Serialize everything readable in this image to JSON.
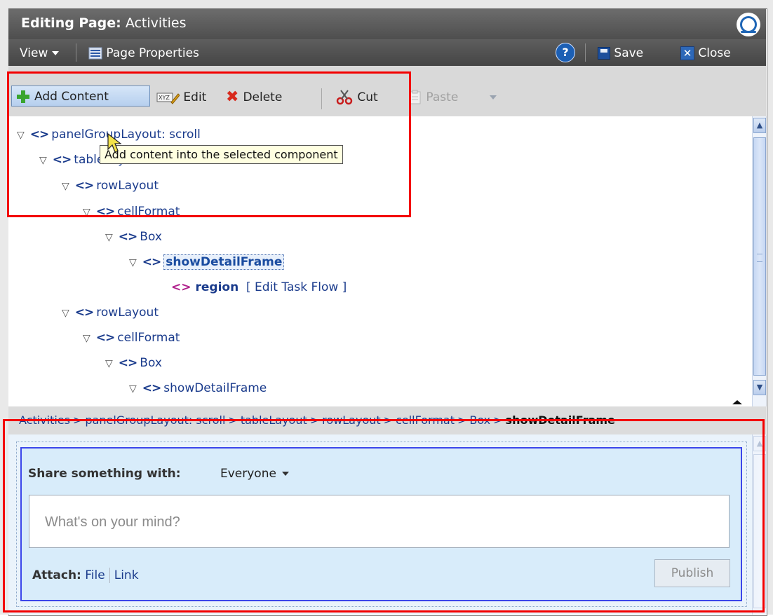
{
  "window": {
    "title_prefix": "Editing Page:",
    "title_page": "Activities"
  },
  "menubar": {
    "view_label": "View",
    "page_properties_label": "Page Properties",
    "help_label": "?",
    "save_label": "Save",
    "close_label": "Close"
  },
  "toolbar": {
    "add_content_label": "Add Content",
    "edit_label": "Edit",
    "delete_label": "Delete",
    "cut_label": "Cut",
    "paste_label": "Paste"
  },
  "tooltip": {
    "text": "Add content into the selected component"
  },
  "tree": {
    "nodes": [
      {
        "label": "panelGroupLayout: scroll"
      },
      {
        "label": "tableLayout"
      },
      {
        "label": "rowLayout"
      },
      {
        "label": "cellFormat"
      },
      {
        "label": "Box"
      },
      {
        "label": "showDetailFrame"
      },
      {
        "label": "region",
        "action": "[ Edit Task Flow ]"
      },
      {
        "label": "rowLayout"
      },
      {
        "label": "cellFormat"
      },
      {
        "label": "Box"
      },
      {
        "label": "showDetailFrame"
      }
    ]
  },
  "breadcrumb": {
    "items": [
      "Activities",
      "panelGroupLayout: scroll",
      "tableLayout",
      "rowLayout",
      "cellFormat",
      "Box"
    ],
    "current": "showDetailFrame",
    "separator": ">"
  },
  "share": {
    "label": "Share something with:",
    "audience": "Everyone",
    "placeholder": "What's on your mind?",
    "attach_label": "Attach:",
    "file_link": "File",
    "link_link": "Link",
    "publish_label": "Publish"
  },
  "colors": {
    "highlight_red": "#f30000",
    "share_border_blue": "#3b46ea",
    "link_blue": "#1a3b8c",
    "add_green": "#3aa52f",
    "delete_red": "#d8291c"
  }
}
